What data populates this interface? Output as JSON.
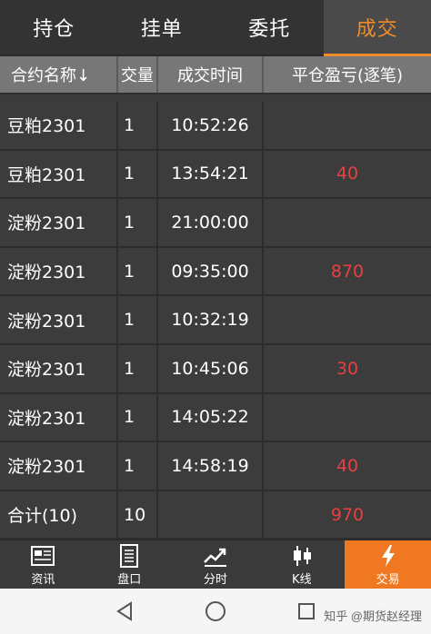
{
  "tabs": [
    {
      "label": "持仓"
    },
    {
      "label": "挂单"
    },
    {
      "label": "委托"
    },
    {
      "label": "成交"
    }
  ],
  "active_tab": 3,
  "table": {
    "headers": [
      "合约名称↓",
      "交量",
      "成交时间",
      "平仓盈亏(逐笔)"
    ],
    "rows": [
      {
        "name": "豆粕2301",
        "qty": "1",
        "time": "10:52:26",
        "pnl": ""
      },
      {
        "name": "豆粕2301",
        "qty": "1",
        "time": "13:54:21",
        "pnl": "40"
      },
      {
        "name": "淀粉2301",
        "qty": "1",
        "time": "21:00:00",
        "pnl": ""
      },
      {
        "name": "淀粉2301",
        "qty": "1",
        "time": "09:35:00",
        "pnl": "870"
      },
      {
        "name": "淀粉2301",
        "qty": "1",
        "time": "10:32:19",
        "pnl": ""
      },
      {
        "name": "淀粉2301",
        "qty": "1",
        "time": "10:45:06",
        "pnl": "30"
      },
      {
        "name": "淀粉2301",
        "qty": "1",
        "time": "14:05:22",
        "pnl": ""
      },
      {
        "name": "淀粉2301",
        "qty": "1",
        "time": "14:58:19",
        "pnl": "40"
      }
    ],
    "total": {
      "name": "合计(10)",
      "qty": "10",
      "time": "",
      "pnl": "970"
    }
  },
  "bottom_nav": [
    {
      "label": "资讯",
      "icon": "news-icon"
    },
    {
      "label": "盘口",
      "icon": "orderbook-icon"
    },
    {
      "label": "分时",
      "icon": "timeshare-chart-icon"
    },
    {
      "label": "K线",
      "icon": "candlestick-icon"
    },
    {
      "label": "交易",
      "icon": "lightning-icon"
    }
  ],
  "active_nav": 4,
  "watermark": "知乎 @期货赵经理",
  "colors": {
    "accent": "#f07820",
    "profit": "#e84040",
    "header_bg": "#777777",
    "row_bg": "#3c3c3c"
  }
}
